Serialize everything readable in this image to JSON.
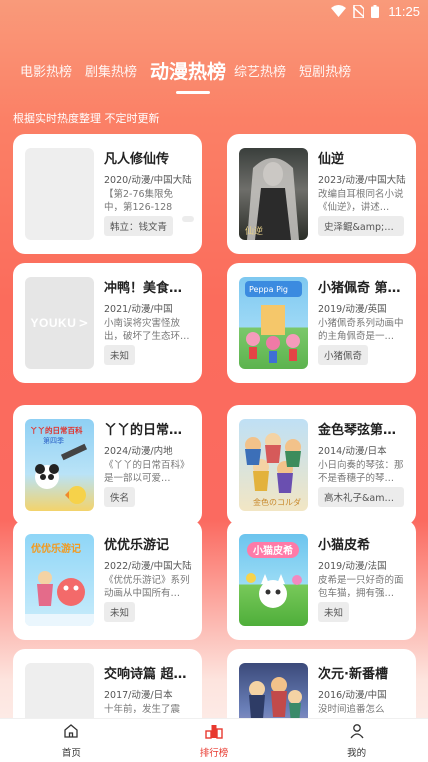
{
  "status_bar": {
    "time": "11:25"
  },
  "tabs": [
    {
      "label": "电影热榜",
      "active": false
    },
    {
      "label": "剧集热榜",
      "active": false
    },
    {
      "label": "动漫热榜",
      "active": true
    },
    {
      "label": "综艺热榜",
      "active": false
    },
    {
      "label": "短剧热榜",
      "active": false
    }
  ],
  "subtitle": "根据实时热度整理 不定时更新",
  "cards": [
    {
      "title": "凡人修仙传",
      "meta": "2020/动漫/中国大陆",
      "desc": "【第2-76集限免中，第126-128集…",
      "tags": [
        "韩立：钱文青",
        ""
      ]
    },
    {
      "title": "仙逆",
      "meta": "2023/动漫/中国大陆",
      "desc": "改编自耳根同名小说《仙逆》，讲述…",
      "tags": [
        "史泽鲲&amp;a..."
      ]
    },
    {
      "title": "冲鸭！美食…",
      "meta": "2021/动漫/中国",
      "desc": "小南误将灾害怪放出，破坏了生态环…",
      "tags": [
        "未知"
      ]
    },
    {
      "title": "小猪佩奇 第…",
      "meta": "2019/动漫/英国",
      "desc": "小猪佩奇系列动画中的主角佩奇是一…",
      "tags": [
        "小猪佩奇"
      ]
    },
    {
      "title": "丫丫的日常…",
      "meta": "2024/动漫/内地",
      "desc": "《丫丫的日常百科》是一部以可爱…",
      "tags": [
        "佚名"
      ]
    },
    {
      "title": "金色琴弦第…",
      "meta": "2014/动漫/日本",
      "desc": "小日向奏的琴弦：那不是香穗子的琴…",
      "tags": [
        "高木礼子&amp;..."
      ]
    },
    {
      "title": "优优乐游记",
      "meta": "2022/动漫/中国大陆",
      "desc": "《优优乐游记》系列动画从中国所有…",
      "tags": [
        "未知"
      ]
    },
    {
      "title": "小猫皮希",
      "meta": "2019/动漫/法国",
      "desc": "皮希是一只好奇的面包车猫，拥有强…",
      "tags": [
        "未知"
      ]
    },
    {
      "title": "交响诗篇 超…",
      "meta": "2017/动漫/日本",
      "desc": "十年前，发生了震",
      "tags": []
    },
    {
      "title": "次元·新番槽",
      "meta": "2016/动漫/中国",
      "desc": "没时间追番怎么",
      "tags": []
    }
  ],
  "poster_text": {
    "youku": "YOUKU",
    "peppa": "Peppa Pig",
    "yaya": "丫丫的日常百科",
    "yaya_sub": "第四季",
    "youyou": "优优乐游记",
    "pixie": "小猫皮希",
    "xianni": "仙逆"
  },
  "bottom_nav": [
    {
      "label": "首页",
      "icon": "home-icon",
      "active": false
    },
    {
      "label": "排行榜",
      "icon": "ranking-icon",
      "active": true
    },
    {
      "label": "我的",
      "icon": "profile-icon",
      "active": false
    }
  ],
  "colors": {
    "accent": "#e8392f",
    "bg_top": "#f99a7a",
    "bg_mid": "#fb6a60"
  }
}
